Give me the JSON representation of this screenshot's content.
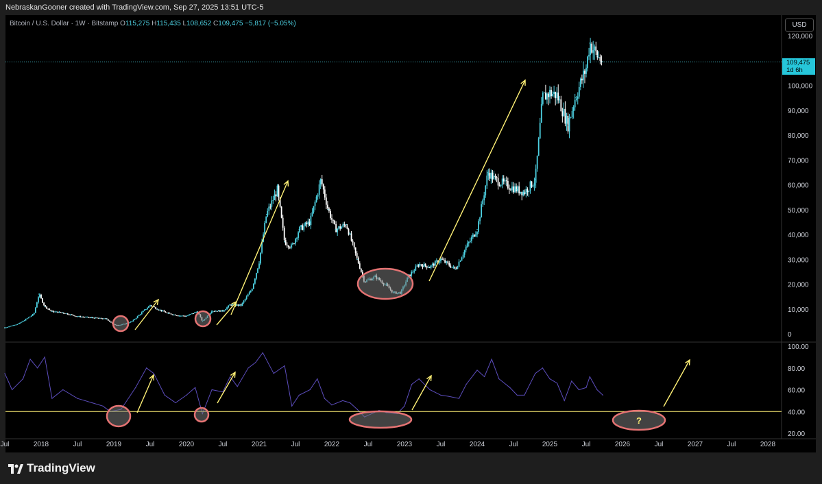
{
  "credit": "NebraskanGooner created with TradingView.com, Sep 27, 2025 13:51 UTC-5",
  "symbol": {
    "name": "Bitcoin / U.S. Dollar · 1W · Bitstamp",
    "open_label": "O",
    "open": "115,275",
    "high_label": "H",
    "high": "115,435",
    "low_label": "L",
    "low": "108,652",
    "close_label": "C",
    "close": "109,475",
    "change": "−5,817 (−5.05%)"
  },
  "currency": "USD",
  "last_price": {
    "value": "109,475",
    "countdown": "1d 6h"
  },
  "logo_text": "TradingView",
  "colors": {
    "candles": "#4dd0e1",
    "annotation": "#fff176",
    "circle": "#e57373",
    "rsi": "#5c4dbd",
    "level": "#fff176",
    "background": "#000000"
  },
  "chart_data": [
    {
      "type": "candlestick",
      "title": "Bitcoin / U.S. Dollar · 1W · Bitstamp",
      "x": [
        2017.5,
        2017.7,
        2017.9,
        2017.97,
        2018.05,
        2018.15,
        2018.3,
        2018.5,
        2018.7,
        2018.9,
        2019.0,
        2019.1,
        2019.25,
        2019.4,
        2019.5,
        2019.6,
        2019.75,
        2019.9,
        2020.0,
        2020.15,
        2020.22,
        2020.35,
        2020.5,
        2020.6,
        2020.75,
        2020.9,
        2021.0,
        2021.1,
        2021.25,
        2021.35,
        2021.45,
        2021.55,
        2021.7,
        2021.85,
        2021.95,
        2022.05,
        2022.2,
        2022.35,
        2022.45,
        2022.6,
        2022.75,
        2022.85,
        2022.95,
        2023.05,
        2023.2,
        2023.35,
        2023.5,
        2023.7,
        2023.85,
        2024.0,
        2024.15,
        2024.25,
        2024.4,
        2024.55,
        2024.65,
        2024.8,
        2024.9,
        2025.0,
        2025.1,
        2025.25,
        2025.35,
        2025.5,
        2025.55,
        2025.65,
        2025.73
      ],
      "values": [
        2500,
        4200,
        8000,
        16000,
        11000,
        9000,
        8500,
        7000,
        6500,
        6000,
        3700,
        3600,
        5000,
        9000,
        11500,
        10000,
        8200,
        7300,
        7200,
        9000,
        5000,
        9300,
        9200,
        11700,
        11500,
        18000,
        29000,
        48000,
        58000,
        37000,
        35000,
        42000,
        45000,
        62000,
        50000,
        42000,
        44000,
        30000,
        21000,
        23000,
        19500,
        16500,
        16600,
        23000,
        28000,
        27000,
        30000,
        26000,
        35000,
        42000,
        65000,
        62000,
        60000,
        58000,
        57000,
        62000,
        95000,
        97000,
        96000,
        84000,
        95000,
        107000,
        117000,
        112000,
        109475
      ],
      "ylim": [
        0,
        125000
      ],
      "yticks": [
        "120,000",
        "110,000",
        "100,000",
        "90,000",
        "80,000",
        "70,000",
        "60,000",
        "50,000",
        "40,000",
        "30,000",
        "20,000",
        "10,000",
        "0"
      ],
      "xticks": [
        "Jul",
        "2018",
        "Jul",
        "2019",
        "Jul",
        "2020",
        "Jul",
        "2021",
        "Jul",
        "2022",
        "Jul",
        "2023",
        "Jul",
        "2024",
        "Jul",
        "2025",
        "Jul",
        "2026",
        "Jul",
        "2027",
        "Jul",
        "2028"
      ]
    },
    {
      "type": "line",
      "x": [
        2017.5,
        2017.6,
        2017.75,
        2017.85,
        2017.95,
        2018.05,
        2018.15,
        2018.3,
        2018.5,
        2018.7,
        2018.85,
        2018.95,
        2019.1,
        2019.3,
        2019.45,
        2019.55,
        2019.7,
        2019.85,
        2020.0,
        2020.12,
        2020.22,
        2020.35,
        2020.5,
        2020.6,
        2020.7,
        2020.85,
        2020.95,
        2021.05,
        2021.2,
        2021.35,
        2021.45,
        2021.55,
        2021.7,
        2021.8,
        2021.9,
        2022.0,
        2022.15,
        2022.25,
        2022.35,
        2022.45,
        2022.55,
        2022.65,
        2022.75,
        2022.9,
        2023.0,
        2023.1,
        2023.2,
        2023.35,
        2023.5,
        2023.6,
        2023.75,
        2023.85,
        2024.0,
        2024.1,
        2024.2,
        2024.3,
        2024.45,
        2024.55,
        2024.65,
        2024.8,
        2024.9,
        2025.0,
        2025.1,
        2025.2,
        2025.3,
        2025.4,
        2025.5,
        2025.55,
        2025.65,
        2025.73
      ],
      "values": [
        75,
        60,
        70,
        88,
        80,
        90,
        52,
        60,
        52,
        48,
        45,
        40,
        42,
        62,
        80,
        75,
        55,
        48,
        55,
        62,
        38,
        60,
        58,
        72,
        63,
        80,
        85,
        94,
        75,
        82,
        45,
        55,
        60,
        70,
        52,
        46,
        50,
        48,
        42,
        35,
        38,
        41,
        39,
        38,
        45,
        65,
        70,
        60,
        55,
        54,
        52,
        65,
        78,
        72,
        88,
        70,
        62,
        55,
        55,
        75,
        80,
        70,
        66,
        50,
        68,
        60,
        62,
        72,
        60,
        55
      ],
      "ylim": [
        20,
        100
      ],
      "yticks": [
        "100.00",
        "80.00",
        "60.00",
        "40.00",
        "20.00"
      ],
      "reference_line": 40,
      "annotation": "?"
    }
  ]
}
